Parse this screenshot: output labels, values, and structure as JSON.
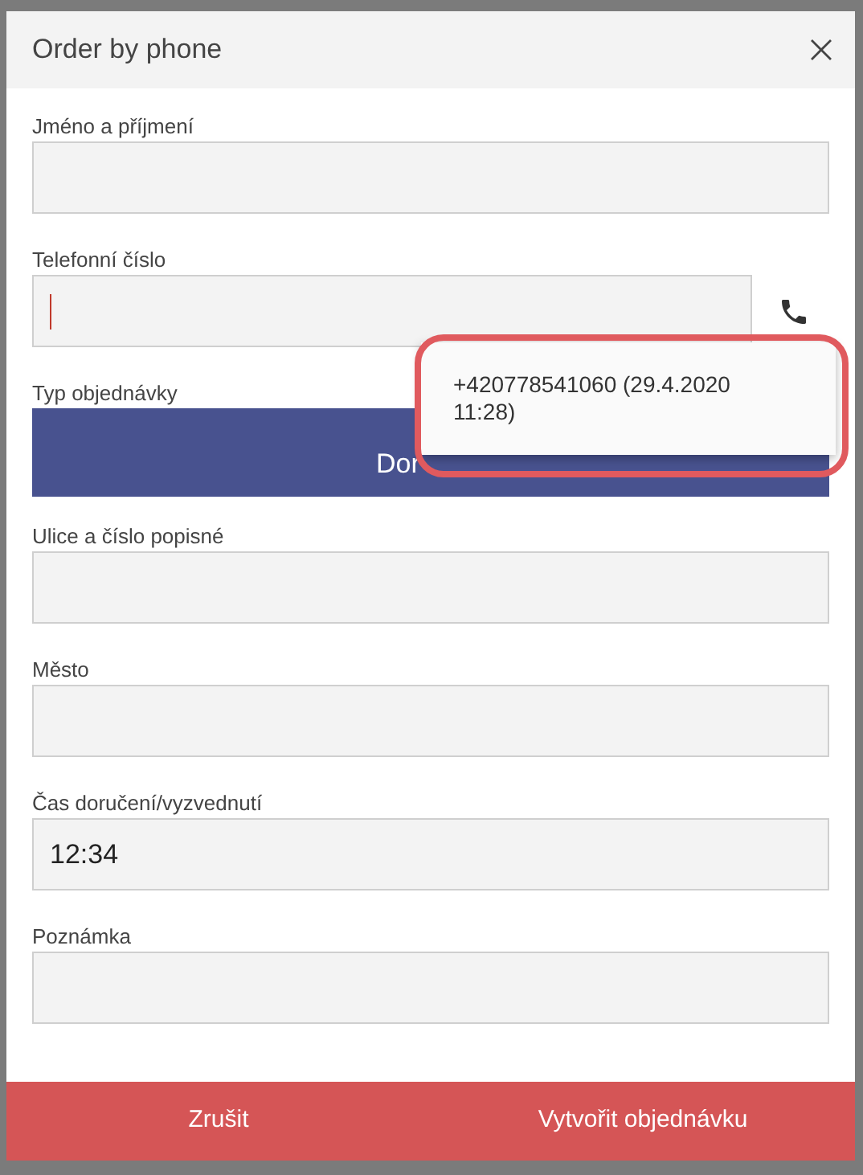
{
  "dialog": {
    "title": "Order by phone"
  },
  "fields": [
    {
      "kind": "text",
      "label": "Jméno a příjmení"
    },
    {
      "kind": "phone",
      "label": "Telefonní číslo",
      "focused": true
    },
    {
      "kind": "choice",
      "label": "Typ objednávky",
      "value": "Dor"
    },
    {
      "kind": "text",
      "label": "Ulice a číslo popisné"
    },
    {
      "kind": "text",
      "label": "Město"
    },
    {
      "kind": "text",
      "label": "Čas doručení/vyzvednutí",
      "value": "12:34"
    },
    {
      "kind": "text",
      "label": "Poznámka"
    }
  ],
  "suggestion": {
    "text": "+420778541060 (29.4.2020 11:28)",
    "highlighted": true
  },
  "buttons": [
    "Zrušit",
    "Vytvořit objednávku"
  ]
}
